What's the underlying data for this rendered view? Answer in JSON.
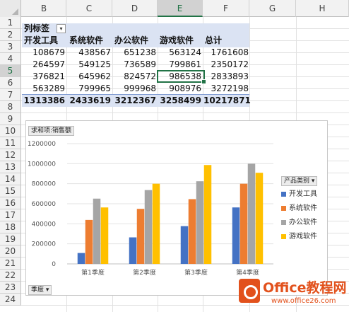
{
  "spreadsheet": {
    "column_headers": [
      "B",
      "C",
      "D",
      "E",
      "F",
      "G",
      "H"
    ],
    "selected_column": "E",
    "row_headers": [
      "1",
      "2",
      "3",
      "4",
      "5",
      "6",
      "7",
      "8",
      "9",
      "10",
      "11",
      "12",
      "13",
      "14",
      "15",
      "16",
      "17",
      "18",
      "19",
      "20",
      "21",
      "22",
      "23",
      "24"
    ],
    "selected_row": "5"
  },
  "pivot_table": {
    "column_labels_caption": "列标签",
    "filter_icon": "filter-dropdown-icon",
    "headers": [
      "开发工具",
      "系统软件",
      "办公软件",
      "游戏软件",
      "总计"
    ],
    "rows": [
      [
        "108679",
        "438567",
        "651238",
        "563124",
        "1761608"
      ],
      [
        "264597",
        "549125",
        "736589",
        "799861",
        "2350172"
      ],
      [
        "376821",
        "645962",
        "824572",
        "986538",
        "2833893"
      ],
      [
        "563289",
        "799965",
        "999968",
        "908976",
        "3272198"
      ]
    ],
    "totals": [
      "1313386",
      "2433619",
      "3212367",
      "3258499",
      "10217871"
    ],
    "active_cell_value": "986538"
  },
  "pivot_chart": {
    "value_field_button": "求和项:销售额",
    "axis_field_button": "季度",
    "legend_field_button": "产品类别",
    "legend_title_icon": "dropdown-arrow-icon"
  },
  "chart_data": {
    "type": "bar",
    "categories": [
      "第1季度",
      "第2季度",
      "第3季度",
      "第4季度"
    ],
    "series": [
      {
        "name": "开发工具",
        "color": "#4472c4",
        "values": [
          108679,
          264597,
          376821,
          563289
        ]
      },
      {
        "name": "系统软件",
        "color": "#ed7d31",
        "values": [
          438567,
          549125,
          645962,
          799965
        ]
      },
      {
        "name": "办公软件",
        "color": "#a5a5a5",
        "values": [
          651238,
          736589,
          824572,
          999968
        ]
      },
      {
        "name": "游戏软件",
        "color": "#ffc000",
        "values": [
          563124,
          799861,
          986538,
          908976
        ]
      }
    ],
    "y_ticks": [
      "0",
      "200000",
      "400000",
      "600000",
      "800000",
      "1000000",
      "1200000"
    ],
    "ylim": [
      0,
      1200000
    ],
    "grid": true,
    "legend_position": "right"
  },
  "watermark": {
    "title": "Office教程网",
    "url": "www.office26.com"
  }
}
